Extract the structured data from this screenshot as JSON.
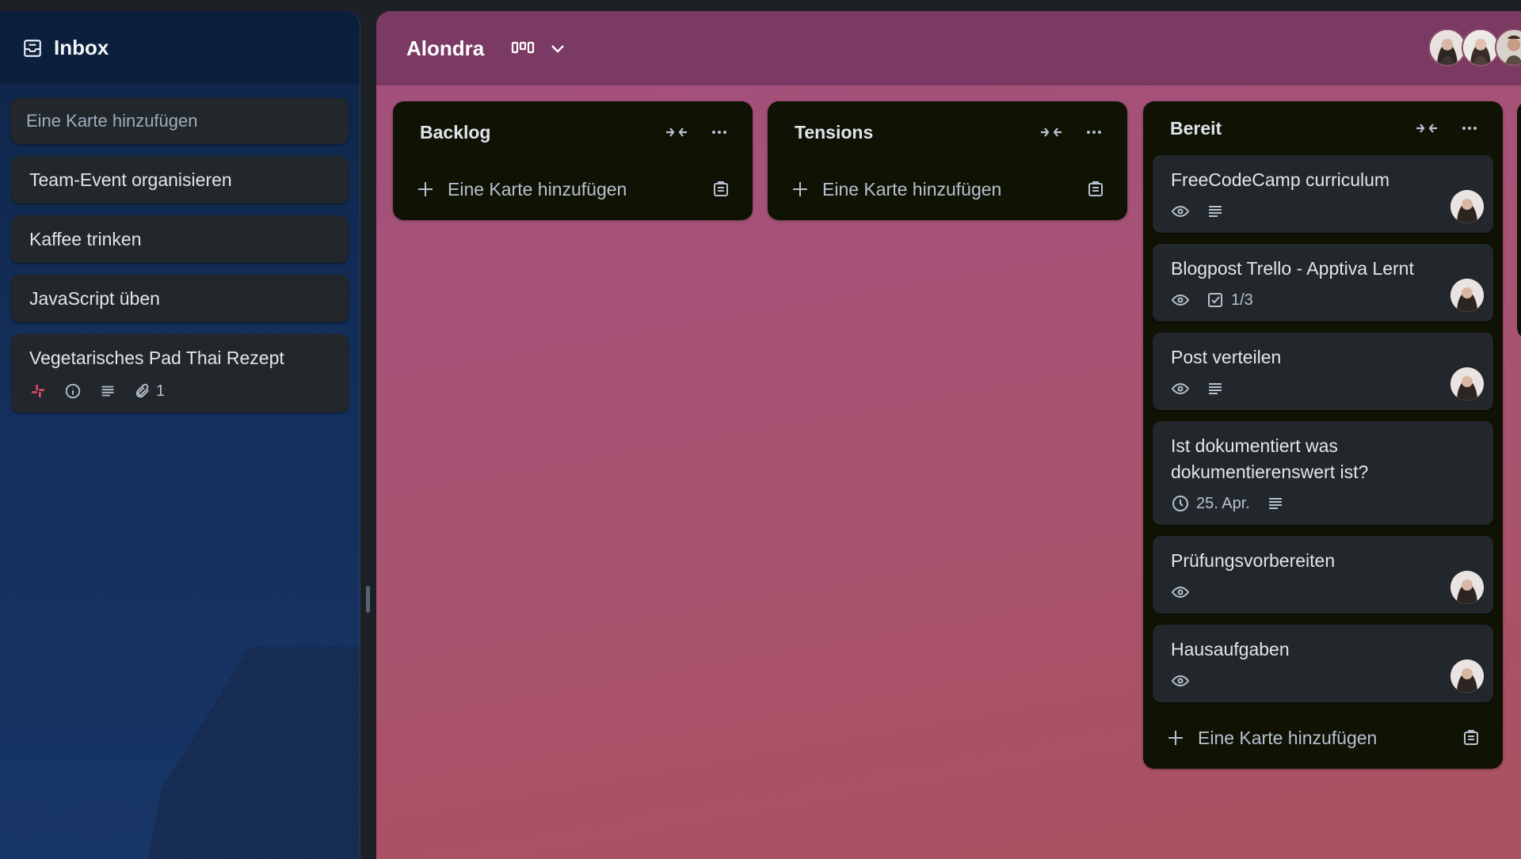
{
  "inbox": {
    "title": "Inbox",
    "add_placeholder": "Eine Karte hinzufügen",
    "cards": [
      {
        "title": "Team-Event organisieren"
      },
      {
        "title": "Kaffee trinken"
      },
      {
        "title": "JavaScript üben"
      },
      {
        "title": "Vegetarisches Pad Thai Rezept",
        "attachments": "1",
        "icons": [
          "slack-icon",
          "info-icon",
          "description-icon",
          "attachment-icon"
        ]
      }
    ]
  },
  "board": {
    "title": "Alondra",
    "lists": [
      {
        "title": "Backlog",
        "add_label": "Eine Karte hinzufügen"
      },
      {
        "title": "Tensions",
        "add_label": "Eine Karte hinzufügen"
      },
      {
        "title": "Bereit",
        "add_label": "Eine Karte hinzufügen",
        "cards": [
          {
            "title": "FreeCodeCamp curriculum"
          },
          {
            "title": "Blogpost Trello - Apptiva Lernt",
            "checklist": "1/3"
          },
          {
            "title": "Post verteilen"
          },
          {
            "title": "Ist dokumentiert was dokumentierenswert ist?",
            "due": "25. Apr."
          },
          {
            "title": "Prüfungsvorbereiten"
          },
          {
            "title": "Hausaufgaben"
          }
        ]
      }
    ]
  },
  "colors": {
    "board_bg": "#a85273",
    "inbox_bg": "#132e59",
    "list_bg": "#101204",
    "card_bg": "#22272b"
  }
}
